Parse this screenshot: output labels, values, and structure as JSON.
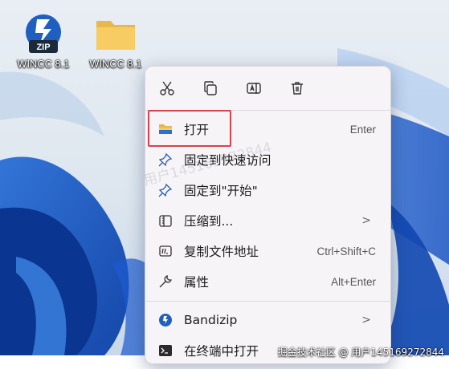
{
  "desktop": {
    "icons": [
      {
        "label": "WINCC 8.1",
        "type": "zip-archive-icon",
        "badge": "ZIP"
      },
      {
        "label": "WINCC 8.1",
        "type": "folder-icon"
      }
    ]
  },
  "context_menu": {
    "toolbar": [
      {
        "icon": "cut-icon"
      },
      {
        "icon": "copy-icon"
      },
      {
        "icon": "rename-icon"
      },
      {
        "icon": "delete-icon"
      }
    ],
    "items": [
      {
        "label": "打开",
        "shortcut": "Enter",
        "icon": "folder-icon"
      },
      {
        "label": "固定到快速访问",
        "shortcut": "",
        "icon": "pin-icon"
      },
      {
        "label": "固定到\"开始\"",
        "shortcut": "",
        "icon": "pin-icon"
      },
      {
        "label": "压缩到...",
        "shortcut": "",
        "icon": "archive-icon",
        "submenu": ">"
      },
      {
        "label": "复制文件地址",
        "shortcut": "Ctrl+Shift+C",
        "icon": "path-icon"
      },
      {
        "label": "属性",
        "shortcut": "Alt+Enter",
        "icon": "wrench-icon"
      },
      {
        "label": "Bandizip",
        "shortcut": "",
        "icon": "bandizip-icon",
        "submenu": ">"
      },
      {
        "label": "在终端中打开",
        "shortcut": "",
        "icon": "terminal-icon"
      }
    ]
  },
  "watermark": "用户145169272844",
  "credit": "掘金技术社区 @ 用户145169272844",
  "colors": {
    "highlight_border": "#d9424a",
    "menu_bg": "#f7f4f7",
    "accent": "#1f5fbf"
  }
}
